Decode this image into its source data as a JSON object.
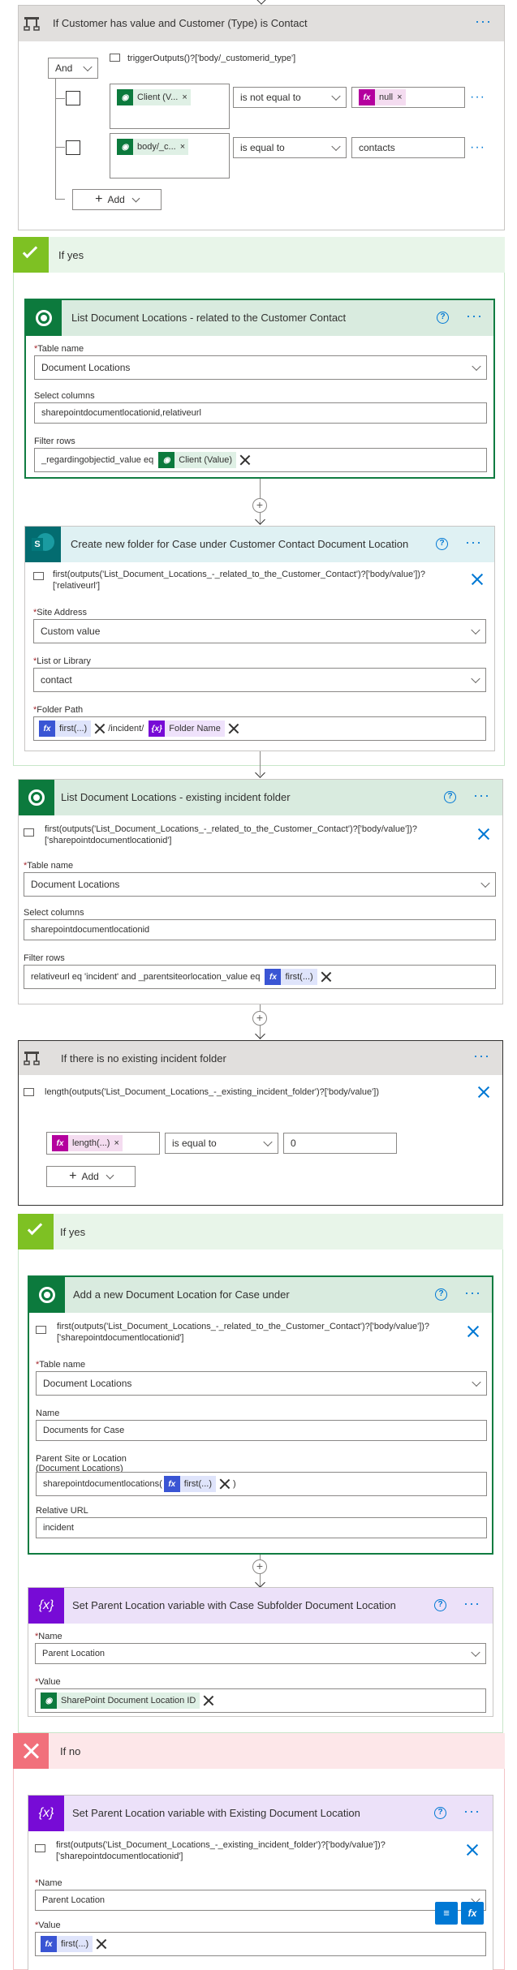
{
  "condition1": {
    "title": "If Customer has value and Customer (Type) is Contact",
    "logic": "And",
    "expression": "triggerOutputs()?['body/_customerid_type']",
    "rows": [
      {
        "left_token": "Client (V...",
        "operator": "is not equal to",
        "right_token": "null",
        "right_text": ""
      },
      {
        "left_token": "body/_c...",
        "operator": "is equal to",
        "right_token": "",
        "right_text": "contacts"
      }
    ],
    "add_label": "Add"
  },
  "branch_yes1": {
    "label": "If yes"
  },
  "list_docs_related": {
    "title": "List Document Locations - related to the Customer Contact",
    "table_label": "Table name",
    "table_value": "Document Locations",
    "select_label": "Select columns",
    "select_value": "sharepointdocumentlocationid,relativeurl",
    "filter_label": "Filter rows",
    "filter_text": "_regardingobjectid_value eq",
    "filter_token": "Client (Value)"
  },
  "create_folder": {
    "title": "Create new folder for Case under Customer Contact Document Location",
    "expression": "first(outputs('List_Document_Locations_-_related_to_the_Customer_Contact')?['body/value'])?['relativeurl']",
    "site_label": "Site Address",
    "site_value": "Custom value",
    "library_label": "List or Library",
    "library_value": "contact",
    "path_label": "Folder Path",
    "path_token1": "first(...)",
    "path_text": "/incident/",
    "path_token2": "Folder Name"
  },
  "list_docs_existing": {
    "title": "List Document Locations - existing incident folder",
    "expression": "first(outputs('List_Document_Locations_-_related_to_the_Customer_Contact')?['body/value'])?['sharepointdocumentlocationid']",
    "table_label": "Table name",
    "table_value": "Document Locations",
    "select_label": "Select columns",
    "select_value": "sharepointdocumentlocationid",
    "filter_label": "Filter rows",
    "filter_text": "relativeurl eq 'incident' and _parentsiteorlocation_value eq",
    "filter_token": "first(...)"
  },
  "condition2": {
    "title": "If there is no existing incident folder",
    "expression": "length(outputs('List_Document_Locations_-_existing_incident_folder')?['body/value'])",
    "left_token": "length(...)",
    "operator": "is equal to",
    "right_text": "0",
    "add_label": "Add"
  },
  "branch_yes2": {
    "label": "If yes"
  },
  "add_doc_location": {
    "title": "Add a new Document Location for Case under",
    "expression": "first(outputs('List_Document_Locations_-_related_to_the_Customer_Contact')?['body/value'])?['sharepointdocumentlocationid']",
    "table_label": "Table name",
    "table_value": "Document Locations",
    "name_label": "Name",
    "name_value": "Documents for Case",
    "parent_label": "Parent Site or Location (Document Locations)",
    "parent_text": "sharepointdocumentlocations(",
    "parent_token": "first(...)",
    "parent_close": ")",
    "url_label": "Relative URL",
    "url_value": "incident"
  },
  "set_var_subfolder": {
    "title": "Set Parent Location variable with Case Subfolder Document Location",
    "name_label": "Name",
    "name_value": "Parent Location",
    "value_label": "Value",
    "value_token": "SharePoint Document Location ID"
  },
  "branch_no": {
    "label": "If no"
  },
  "set_var_existing": {
    "title": "Set Parent Location variable with Existing Document Location",
    "expression": "first(outputs('List_Document_Locations_-_existing_incident_folder')?['body/value'])?['sharepointdocumentlocationid']",
    "name_label": "Name",
    "name_value": "Parent Location",
    "value_label": "Value",
    "value_token": "first(...)"
  },
  "icons": {
    "condition": "condition-icon",
    "dataverse": "dataverse-icon",
    "sharepoint": "sharepoint-icon",
    "variable": "variable-icon",
    "fx": "fx-icon"
  },
  "colors": {
    "accent": "#0078d4",
    "yes_band": "#e8f5e9",
    "no_band": "#fde7e9",
    "dataverse": "#0c7a3d",
    "variable": "#770bd6",
    "condition_header": "#e1dfdd"
  }
}
